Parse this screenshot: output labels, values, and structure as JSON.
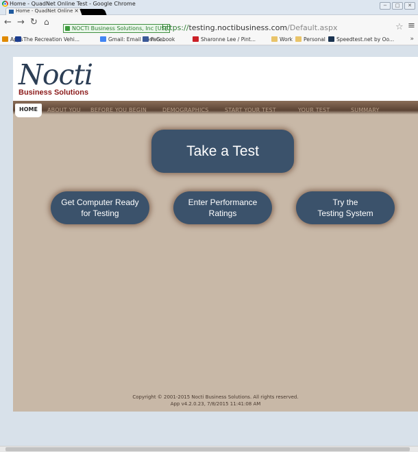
{
  "window": {
    "title": "Home - QuadNet Online Test - Google Chrome",
    "controls": [
      "−",
      "□",
      "✕"
    ]
  },
  "tab": {
    "label": "Home - QuadNet Online",
    "close": "×"
  },
  "address_bar": {
    "security_label": "NOCTI Business Solutions, Inc [US]",
    "url_scheme": "https://",
    "url_host": "testing.noctibusiness.com",
    "url_path": "/Default.aspx"
  },
  "bookmarks": [
    {
      "label": "Apps",
      "icon": "apps-grid-icon",
      "color": "#e08a00"
    },
    {
      "label": "The Recreation Vehi...",
      "icon": "rv-icon",
      "color": "#1c3d8f"
    },
    {
      "label": "Gmail: Email from G...",
      "icon": "google-icon",
      "color": "#4285f4"
    },
    {
      "label": "Facebook",
      "icon": "facebook-icon",
      "color": "#3b5998"
    },
    {
      "label": "Sharonne Lee / Pint...",
      "icon": "pinterest-icon",
      "color": "#cb2027"
    },
    {
      "label": "Work",
      "icon": "folder-icon",
      "color": "#e9c46a"
    },
    {
      "label": "Personal",
      "icon": "folder-icon",
      "color": "#e9c46a"
    },
    {
      "label": "Speedtest.net by Oo...",
      "icon": "speedtest-icon",
      "color": "#1a3350"
    }
  ],
  "bookmarks_more": "»",
  "site": {
    "logo_script": "Nocti",
    "logo_sub": "Business Solutions",
    "nav": [
      "HOME",
      "ABOUT YOU",
      "BEFORE YOU BEGIN",
      "DEMOGRAPHICS",
      "START YOUR TEST",
      "YOUR TEST",
      "SUMMARY"
    ],
    "main_button": "Take a Test",
    "buttons": [
      {
        "line1": "Get Computer Ready",
        "line2": "for Testing"
      },
      {
        "line1": "Enter Performance",
        "line2": "Ratings"
      },
      {
        "line1": "Try the",
        "line2": "Testing System"
      }
    ],
    "footer_copyright": "Copyright © 2001-2015  Nocti Business Solutions. All rights reserved.",
    "footer_version": "App v4.2.0.23, 7/8/2015 11:41:08 AM"
  },
  "colors": {
    "button_bg": "#3b526b",
    "site_bg": "#c8b8a7",
    "brand_red": "#8b1a1a"
  }
}
